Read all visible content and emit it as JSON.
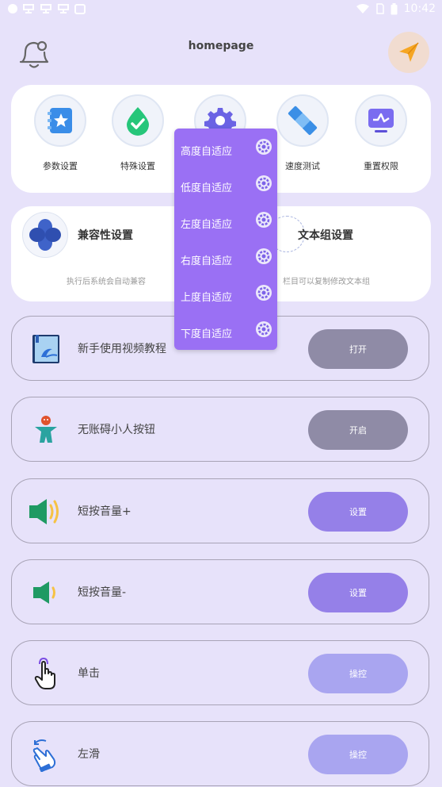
{
  "status_bar": {
    "time": "10:42"
  },
  "header": {
    "title": "homepage"
  },
  "grid": {
    "items": [
      {
        "label": "参数设置",
        "icon": "star-book-icon"
      },
      {
        "label": "特殊设置",
        "icon": "water-check-icon"
      },
      {
        "label": "",
        "icon": "gear-icon"
      },
      {
        "label": "速度测试",
        "icon": "satellite-icon"
      },
      {
        "label": "重置权限",
        "icon": "monitor-icon"
      }
    ]
  },
  "compat": {
    "title": "兼容性设置",
    "desc": "执行后系统会自动兼容",
    "text_title": "文本组设置",
    "text_desc": "栏目可以复制修改文本组"
  },
  "dropdown": {
    "items": [
      {
        "label": "高度自适应"
      },
      {
        "label": "低度自适应"
      },
      {
        "label": "左度自适应"
      },
      {
        "label": "右度自适应"
      },
      {
        "label": "上度自适应"
      },
      {
        "label": "下度自适应"
      }
    ]
  },
  "rows": [
    {
      "label": "新手使用视频教程",
      "button": "打开",
      "button_color": "#8f8ba6",
      "icon": "tutorial-book-icon"
    },
    {
      "label": "无账碍小人按钮",
      "button": "开启",
      "button_color": "#8f8ba6",
      "icon": "little-person-icon"
    },
    {
      "label": "短按音量+",
      "button": "设置",
      "button_color": "#9580e8",
      "icon": "volume-up-icon"
    },
    {
      "label": "短按音量-",
      "button": "设置",
      "button_color": "#9580e8",
      "icon": "volume-down-icon"
    },
    {
      "label": "单击",
      "button": "操控",
      "button_color": "#a9a5f0",
      "icon": "tap-hand-icon"
    },
    {
      "label": "左滑",
      "button": "操控",
      "button_color": "#a9a5f0",
      "icon": "swipe-hand-icon"
    }
  ]
}
